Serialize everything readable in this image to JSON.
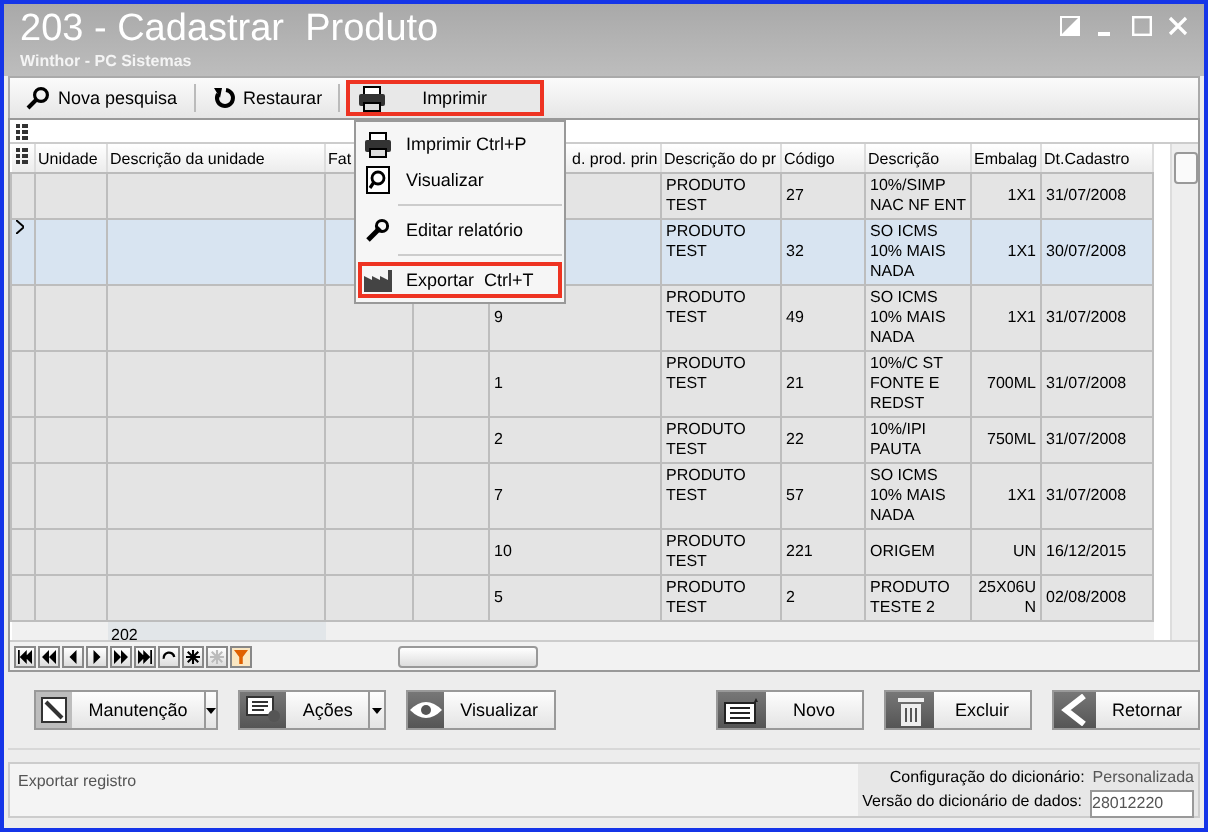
{
  "window": {
    "title": "203 - Cadastrar  Produto",
    "subtitle": "Winthor - PC Sistemas"
  },
  "toolbar": [
    {
      "kind": "search",
      "label": "Nova pesquisa",
      "highlighted": false
    },
    {
      "kind": "restore",
      "label": "Restaurar",
      "highlighted": false
    },
    {
      "kind": "print",
      "label": "Imprimir",
      "highlighted": true
    }
  ],
  "print_menu": [
    {
      "kind": "print",
      "label": "Imprimir Ctrl+P",
      "highlighted": false
    },
    {
      "kind": "preview",
      "label": "Visualizar",
      "highlighted": false
    },
    {
      "kind": "edit",
      "label": "Editar relatório",
      "highlighted": false
    },
    {
      "kind": "export",
      "label": "Exportar  Ctrl+T",
      "highlighted": true
    }
  ],
  "table": {
    "headers": {
      "unidade": "Unidade",
      "descricao_da_unidade": "Descrição da unidade",
      "fat": "Fat",
      "prod_princ": "d. prod. prin",
      "descricao_do_pr": "Descrição do pr",
      "codigo": "Código",
      "descricao": "Descrição",
      "embalag": "Embalag",
      "dt_cadastro": "Dt.Cadastro"
    },
    "rows": [
      {
        "selected": false,
        "descricao_do_pr": "PRODUTO TEST",
        "codigo": "27",
        "descricao": "10%/SIMP NAC NF ENT",
        "embalag": "1X1",
        "dt_cadastro": "31/07/2008"
      },
      {
        "selected": true,
        "descricao_do_pr": "PRODUTO TEST",
        "codigo": "32",
        "descricao": "SO ICMS 10% MAIS NADA",
        "embalag": "1X1",
        "dt_cadastro": "30/07/2008"
      },
      {
        "selected": false,
        "prod_princ": "9",
        "descricao_do_pr": "PRODUTO TEST",
        "codigo": "49",
        "descricao": "SO ICMS 10% MAIS NADA",
        "embalag": "1X1",
        "dt_cadastro": "31/07/2008"
      },
      {
        "selected": false,
        "prod_princ": "1",
        "descricao_do_pr": "PRODUTO TEST",
        "codigo": "21",
        "descricao": "10%/C ST FONTE E REDST",
        "embalag": "700ML",
        "dt_cadastro": "31/07/2008"
      },
      {
        "selected": false,
        "prod_princ": "2",
        "descricao_do_pr": "PRODUTO TEST",
        "codigo": "22",
        "descricao": "10%/IPI PAUTA",
        "embalag": "750ML",
        "dt_cadastro": "31/07/2008"
      },
      {
        "selected": false,
        "prod_princ": "7",
        "descricao_do_pr": "PRODUTO TEST",
        "codigo": "57",
        "descricao": "SO ICMS 10% MAIS NADA",
        "embalag": "1X1",
        "dt_cadastro": "31/07/2008"
      },
      {
        "selected": false,
        "prod_princ": "10",
        "descricao_do_pr": "PRODUTO TEST",
        "codigo": "221",
        "descricao": "ORIGEM",
        "embalag": "UN",
        "dt_cadastro": "16/12/2015"
      },
      {
        "selected": false,
        "prod_princ": "5",
        "descricao_do_pr": "PRODUTO TEST",
        "codigo": "2",
        "descricao": "PRODUTO TESTE 2",
        "embalag": "25X06UN",
        "dt_cadastro": "02/08/2008"
      }
    ],
    "footer": {
      "descricao_da_unidade": "202"
    }
  },
  "buttons": [
    {
      "kind": "maintenance",
      "label": "Manutenção",
      "dropdown": true
    },
    {
      "kind": "actions",
      "label": "Ações",
      "dropdown": true
    },
    {
      "kind": "view",
      "label": "Visualizar",
      "dropdown": false
    },
    {
      "kind": "new",
      "label": "Novo",
      "dropdown": false
    },
    {
      "kind": "delete",
      "label": "Excluir",
      "dropdown": false
    },
    {
      "kind": "back",
      "label": "Retornar",
      "dropdown": false
    }
  ],
  "status_bar": {
    "message": "Exportar registro",
    "config_label": "Configuração do dicionário:",
    "config_value": "Personalizada",
    "version_label": "Versão do dicionário de dados:",
    "version_value": "28012220"
  }
}
